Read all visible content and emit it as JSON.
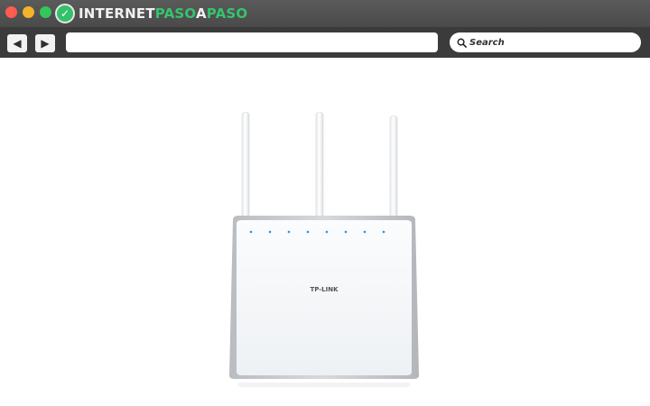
{
  "window": {
    "traffic_lights": {
      "close": "#ff5b51",
      "minimize": "#f4b42a",
      "maximize": "#33c65a"
    }
  },
  "logo": {
    "part1": "INTERNET",
    "part2": "PASO",
    "part3": "A",
    "part4": "PASO",
    "colors": {
      "white": "#f1f1f1",
      "green": "#36c46d"
    }
  },
  "toolbar": {
    "back_icon": "◀",
    "forward_icon": "▶",
    "address_value": "",
    "search_placeholder": "Search"
  },
  "content": {
    "image": "router-photo",
    "brand_label": "TP-LINK",
    "led_color": "#2c93e0"
  }
}
